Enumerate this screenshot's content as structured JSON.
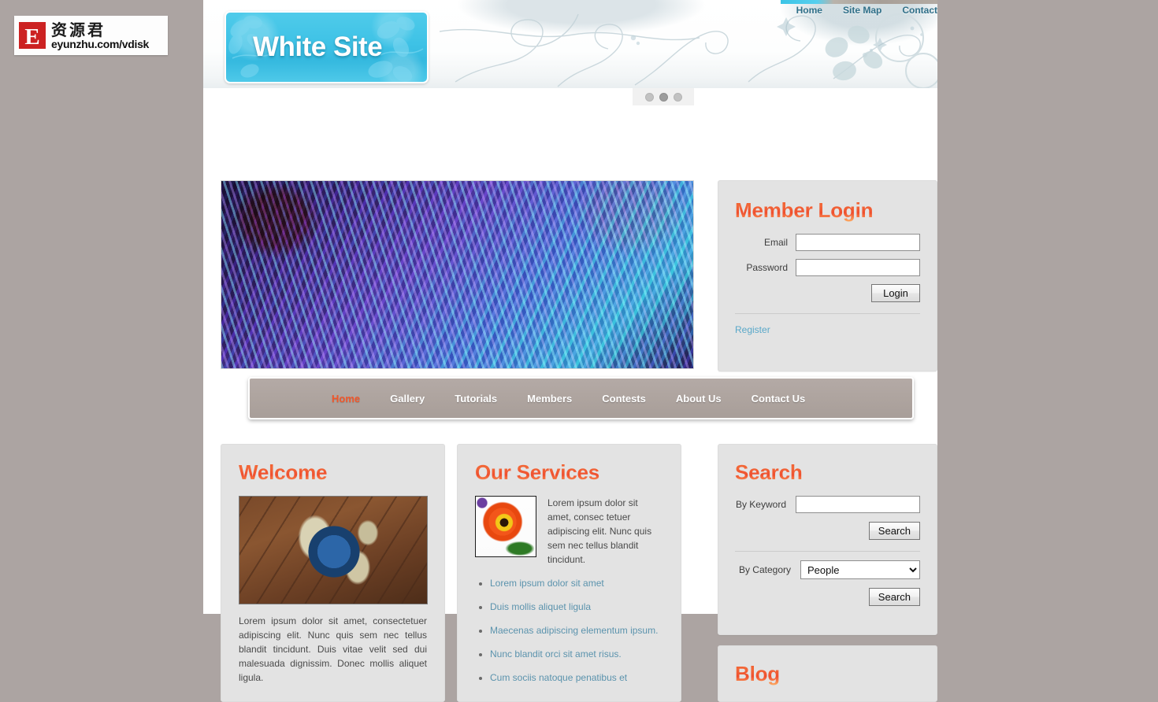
{
  "watermark": {
    "badge_letter": "E",
    "chinese": "资源君",
    "url": "eyunzhu.com/vdisk"
  },
  "header": {
    "site_title": "White Site",
    "top_nav": [
      {
        "label": "Home"
      },
      {
        "label": "Site Map"
      },
      {
        "label": "Contact"
      }
    ]
  },
  "slider": {
    "dots": [
      {
        "active": false
      },
      {
        "active": true
      },
      {
        "active": false
      }
    ],
    "image_alt": "sea-anemone-photo"
  },
  "login": {
    "title": "Member Login",
    "email_label": "Email",
    "email_value": "",
    "email_placeholder": "",
    "password_label": "Password",
    "password_value": "",
    "password_placeholder": "",
    "login_button": "Login",
    "register_link": "Register"
  },
  "main_nav": {
    "items": [
      {
        "label": "Home",
        "active": true
      },
      {
        "label": "Gallery",
        "active": false
      },
      {
        "label": "Tutorials",
        "active": false
      },
      {
        "label": "Members",
        "active": false
      },
      {
        "label": "Contests",
        "active": false
      },
      {
        "label": "About Us",
        "active": false
      },
      {
        "label": "Contact Us",
        "active": false
      }
    ]
  },
  "welcome": {
    "title": "Welcome",
    "image_alt": "globe-photo",
    "body": "Lorem ipsum dolor sit amet, consectetuer adipiscing elit. Nunc quis sem nec tellus blandit tincidunt. Duis vitae velit sed dui malesuada dignissim. Donec mollis aliquet ligula."
  },
  "services": {
    "title": "Our Services",
    "image_alt": "orange-flower-photo",
    "intro": "Lorem ipsum dolor sit amet, consec tetuer adipiscing elit. Nunc quis sem nec tellus blandit tincidunt.",
    "links": [
      {
        "label": "Lorem ipsum dolor sit amet"
      },
      {
        "label": "Duis mollis aliquet ligula"
      },
      {
        "label": "Maecenas adipiscing elementum ipsum."
      },
      {
        "label": "Nunc blandit orci sit amet risus."
      },
      {
        "label": "Cum sociis natoque penatibus et"
      }
    ]
  },
  "search": {
    "title": "Search",
    "keyword_label": "By Keyword",
    "keyword_value": "",
    "keyword_placeholder": "",
    "keyword_button": "Search",
    "category_label": "By Category",
    "category_selected": "People",
    "category_button": "Search"
  },
  "blog": {
    "title": "Blog",
    "cut_left": "",
    "cut_right": ""
  },
  "colors": {
    "accent_orange": "#f0572b",
    "logo_cyan": "#3ec2e6",
    "link_blue": "#59a8c9",
    "nav_taupe": "#aea49f",
    "panel_grey": "#e3e3e3",
    "page_outside": "#aca4a2"
  }
}
